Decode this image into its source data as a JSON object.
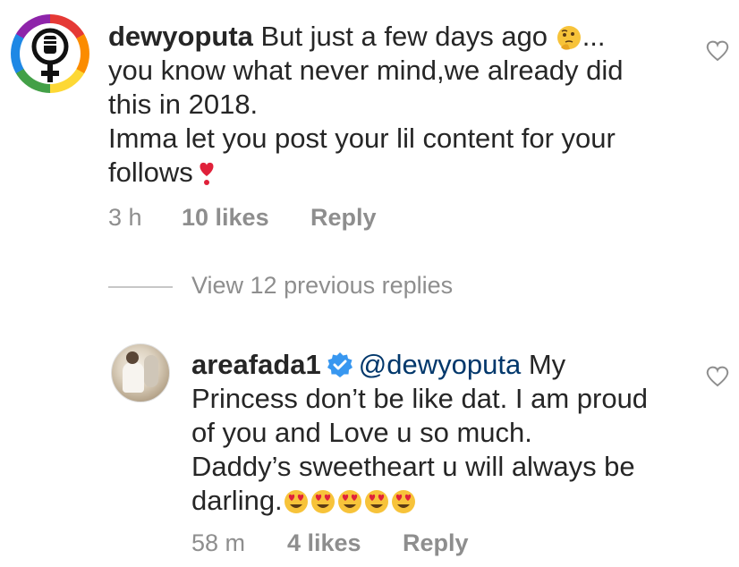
{
  "comments": [
    {
      "username": "dewyoputa",
      "avatar": "feminist-fist-rainbow-avatar",
      "lines": [
        "But just a few days ago",
        "you know what never mind,we already did",
        "this in 2018.",
        "Imma let you post your lil content for your",
        "follows"
      ],
      "trail_1": "...",
      "emojis": [
        "thinking-face",
        "red-heart-exclamation"
      ],
      "time": "3 h",
      "likes": "10 likes",
      "reply": "Reply"
    },
    {
      "username": "areafada1",
      "verified": true,
      "mention": "@dewyoputa",
      "lines": [
        "My",
        "Princess don’t be like dat. I am proud",
        "of you and Love u so much.",
        "Daddy’s sweetheart u will always be",
        "darling."
      ],
      "emojis": [
        "heart-eyes",
        "heart-eyes",
        "heart-eyes",
        "heart-eyes",
        "heart-eyes"
      ],
      "time": "58 m",
      "likes": "4 likes",
      "reply": "Reply"
    }
  ],
  "view_replies": "View 12 previous replies",
  "colors": {
    "text": "#262626",
    "muted": "#8e8e8e",
    "mention": "#00376b",
    "verified": "#3897f0"
  }
}
